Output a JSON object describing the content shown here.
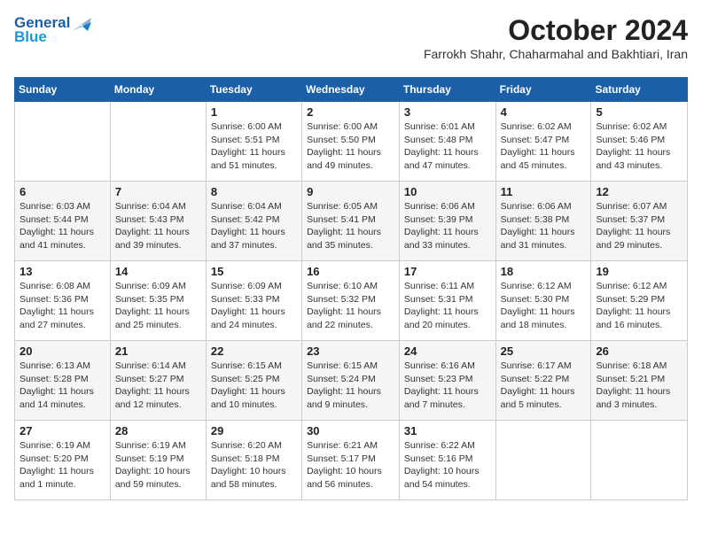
{
  "header": {
    "logo_line1": "General",
    "logo_line2": "Blue",
    "month_title": "October 2024",
    "location": "Farrokh Shahr, Chaharmahal and Bakhtiari, Iran"
  },
  "days_of_week": [
    "Sunday",
    "Monday",
    "Tuesday",
    "Wednesday",
    "Thursday",
    "Friday",
    "Saturday"
  ],
  "weeks": [
    [
      {
        "day": "",
        "info": ""
      },
      {
        "day": "",
        "info": ""
      },
      {
        "day": "1",
        "info": "Sunrise: 6:00 AM\nSunset: 5:51 PM\nDaylight: 11 hours and 51 minutes."
      },
      {
        "day": "2",
        "info": "Sunrise: 6:00 AM\nSunset: 5:50 PM\nDaylight: 11 hours and 49 minutes."
      },
      {
        "day": "3",
        "info": "Sunrise: 6:01 AM\nSunset: 5:48 PM\nDaylight: 11 hours and 47 minutes."
      },
      {
        "day": "4",
        "info": "Sunrise: 6:02 AM\nSunset: 5:47 PM\nDaylight: 11 hours and 45 minutes."
      },
      {
        "day": "5",
        "info": "Sunrise: 6:02 AM\nSunset: 5:46 PM\nDaylight: 11 hours and 43 minutes."
      }
    ],
    [
      {
        "day": "6",
        "info": "Sunrise: 6:03 AM\nSunset: 5:44 PM\nDaylight: 11 hours and 41 minutes."
      },
      {
        "day": "7",
        "info": "Sunrise: 6:04 AM\nSunset: 5:43 PM\nDaylight: 11 hours and 39 minutes."
      },
      {
        "day": "8",
        "info": "Sunrise: 6:04 AM\nSunset: 5:42 PM\nDaylight: 11 hours and 37 minutes."
      },
      {
        "day": "9",
        "info": "Sunrise: 6:05 AM\nSunset: 5:41 PM\nDaylight: 11 hours and 35 minutes."
      },
      {
        "day": "10",
        "info": "Sunrise: 6:06 AM\nSunset: 5:39 PM\nDaylight: 11 hours and 33 minutes."
      },
      {
        "day": "11",
        "info": "Sunrise: 6:06 AM\nSunset: 5:38 PM\nDaylight: 11 hours and 31 minutes."
      },
      {
        "day": "12",
        "info": "Sunrise: 6:07 AM\nSunset: 5:37 PM\nDaylight: 11 hours and 29 minutes."
      }
    ],
    [
      {
        "day": "13",
        "info": "Sunrise: 6:08 AM\nSunset: 5:36 PM\nDaylight: 11 hours and 27 minutes."
      },
      {
        "day": "14",
        "info": "Sunrise: 6:09 AM\nSunset: 5:35 PM\nDaylight: 11 hours and 25 minutes."
      },
      {
        "day": "15",
        "info": "Sunrise: 6:09 AM\nSunset: 5:33 PM\nDaylight: 11 hours and 24 minutes."
      },
      {
        "day": "16",
        "info": "Sunrise: 6:10 AM\nSunset: 5:32 PM\nDaylight: 11 hours and 22 minutes."
      },
      {
        "day": "17",
        "info": "Sunrise: 6:11 AM\nSunset: 5:31 PM\nDaylight: 11 hours and 20 minutes."
      },
      {
        "day": "18",
        "info": "Sunrise: 6:12 AM\nSunset: 5:30 PM\nDaylight: 11 hours and 18 minutes."
      },
      {
        "day": "19",
        "info": "Sunrise: 6:12 AM\nSunset: 5:29 PM\nDaylight: 11 hours and 16 minutes."
      }
    ],
    [
      {
        "day": "20",
        "info": "Sunrise: 6:13 AM\nSunset: 5:28 PM\nDaylight: 11 hours and 14 minutes."
      },
      {
        "day": "21",
        "info": "Sunrise: 6:14 AM\nSunset: 5:27 PM\nDaylight: 11 hours and 12 minutes."
      },
      {
        "day": "22",
        "info": "Sunrise: 6:15 AM\nSunset: 5:25 PM\nDaylight: 11 hours and 10 minutes."
      },
      {
        "day": "23",
        "info": "Sunrise: 6:15 AM\nSunset: 5:24 PM\nDaylight: 11 hours and 9 minutes."
      },
      {
        "day": "24",
        "info": "Sunrise: 6:16 AM\nSunset: 5:23 PM\nDaylight: 11 hours and 7 minutes."
      },
      {
        "day": "25",
        "info": "Sunrise: 6:17 AM\nSunset: 5:22 PM\nDaylight: 11 hours and 5 minutes."
      },
      {
        "day": "26",
        "info": "Sunrise: 6:18 AM\nSunset: 5:21 PM\nDaylight: 11 hours and 3 minutes."
      }
    ],
    [
      {
        "day": "27",
        "info": "Sunrise: 6:19 AM\nSunset: 5:20 PM\nDaylight: 11 hours and 1 minute."
      },
      {
        "day": "28",
        "info": "Sunrise: 6:19 AM\nSunset: 5:19 PM\nDaylight: 10 hours and 59 minutes."
      },
      {
        "day": "29",
        "info": "Sunrise: 6:20 AM\nSunset: 5:18 PM\nDaylight: 10 hours and 58 minutes."
      },
      {
        "day": "30",
        "info": "Sunrise: 6:21 AM\nSunset: 5:17 PM\nDaylight: 10 hours and 56 minutes."
      },
      {
        "day": "31",
        "info": "Sunrise: 6:22 AM\nSunset: 5:16 PM\nDaylight: 10 hours and 54 minutes."
      },
      {
        "day": "",
        "info": ""
      },
      {
        "day": "",
        "info": ""
      }
    ]
  ]
}
